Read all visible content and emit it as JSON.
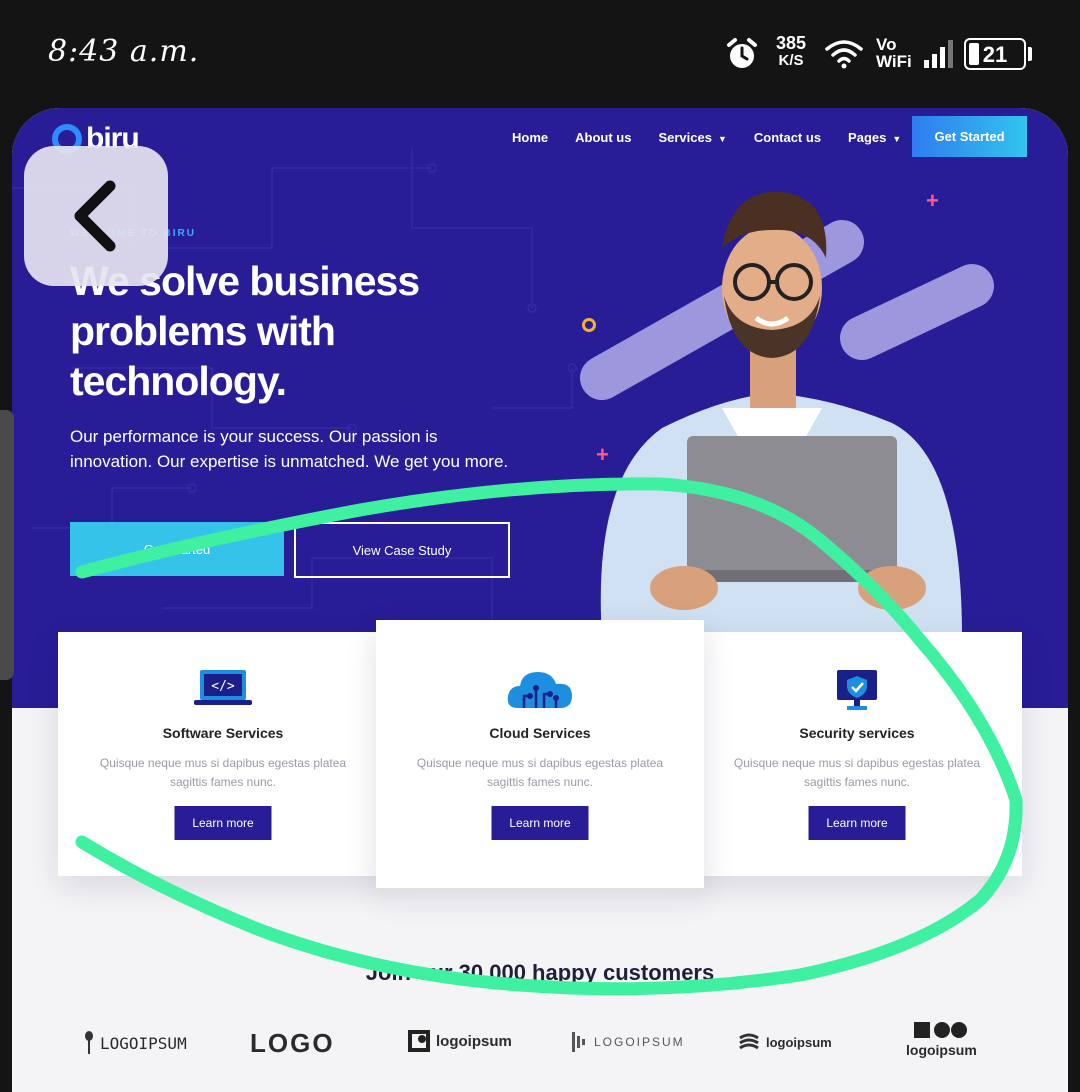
{
  "status_bar": {
    "time": "8:43 a.m.",
    "speed_value": "385",
    "speed_unit": "K/S",
    "vo": "Vo",
    "wifi": "WiFi",
    "battery": "21",
    "icons": [
      "alarm-icon",
      "wifi-icon",
      "signal-icon",
      "battery-icon"
    ]
  },
  "site": {
    "logo": "biru",
    "nav": {
      "items": [
        "Home",
        "About us",
        "Services",
        "Contact us",
        "Pages"
      ],
      "cta": "Get Started"
    },
    "hero": {
      "eyebrow": "WELCOME TO BIRU",
      "headline": "We solve business problems with technology.",
      "lead": "Our performance is your success. Our passion is innovation. Our expertise is unmatched. We get you more.",
      "primary_button": "Get Started",
      "secondary_button": "View Case Study"
    },
    "services": [
      {
        "title": "Software Services",
        "text": "Quisque neque mus si dapibus egestas platea sagittis fames nunc.",
        "button": "Learn more",
        "icon": "code-laptop-icon"
      },
      {
        "title": "Cloud Services",
        "text": "Quisque neque mus si dapibus egestas platea sagittis fames nunc.",
        "button": "Learn more",
        "icon": "cloud-circuit-icon"
      },
      {
        "title": "Security services",
        "text": "Quisque neque mus si dapibus egestas platea sagittis fames nunc.",
        "button": "Learn more",
        "icon": "shield-monitor-icon"
      }
    ],
    "customers_heading": "Join our 30,000 happy customers",
    "brand_logos": [
      "LOGOIPSUM",
      "LOGO",
      "logoipsum",
      "LOGOIPSUM",
      "logoipsum",
      "logoipsum"
    ]
  },
  "colors": {
    "hero_bg": "#281d96",
    "accent_cyan": "#36c3ea",
    "annotation_green": "#3ef0a0"
  }
}
